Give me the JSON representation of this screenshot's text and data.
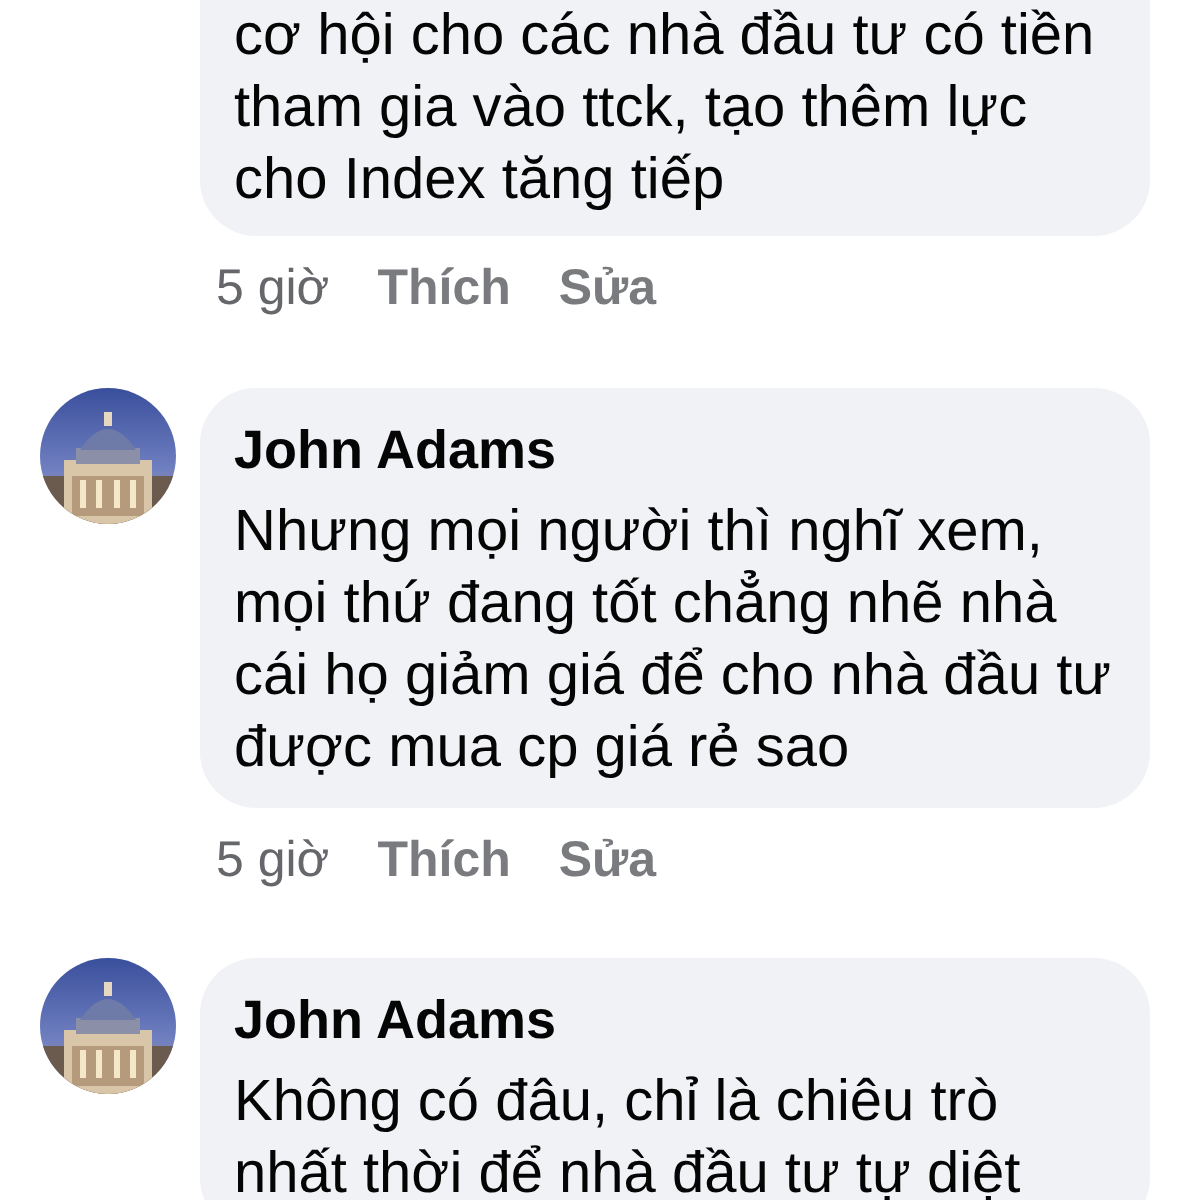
{
  "comments": [
    {
      "text": "cơ hội cho các nhà đầu tư có tiền tham gia vào ttck, tạo thêm lực cho Index tăng tiếp",
      "time": "5 giờ",
      "actions": [
        "Thích",
        "Sửa"
      ]
    },
    {
      "author": "John Adams",
      "text": "Nhưng mọi người thì nghĩ xem, mọi thứ đang tốt chẳng nhẽ nhà cái họ giảm giá để cho nhà đầu tư được mua cp giá rẻ sao",
      "time": "5 giờ",
      "actions": [
        "Thích",
        "Sửa"
      ]
    },
    {
      "author": "John Adams",
      "text": "Không có đâu, chỉ là chiêu trò nhất thời để nhà đầu tư tự diệt"
    }
  ]
}
